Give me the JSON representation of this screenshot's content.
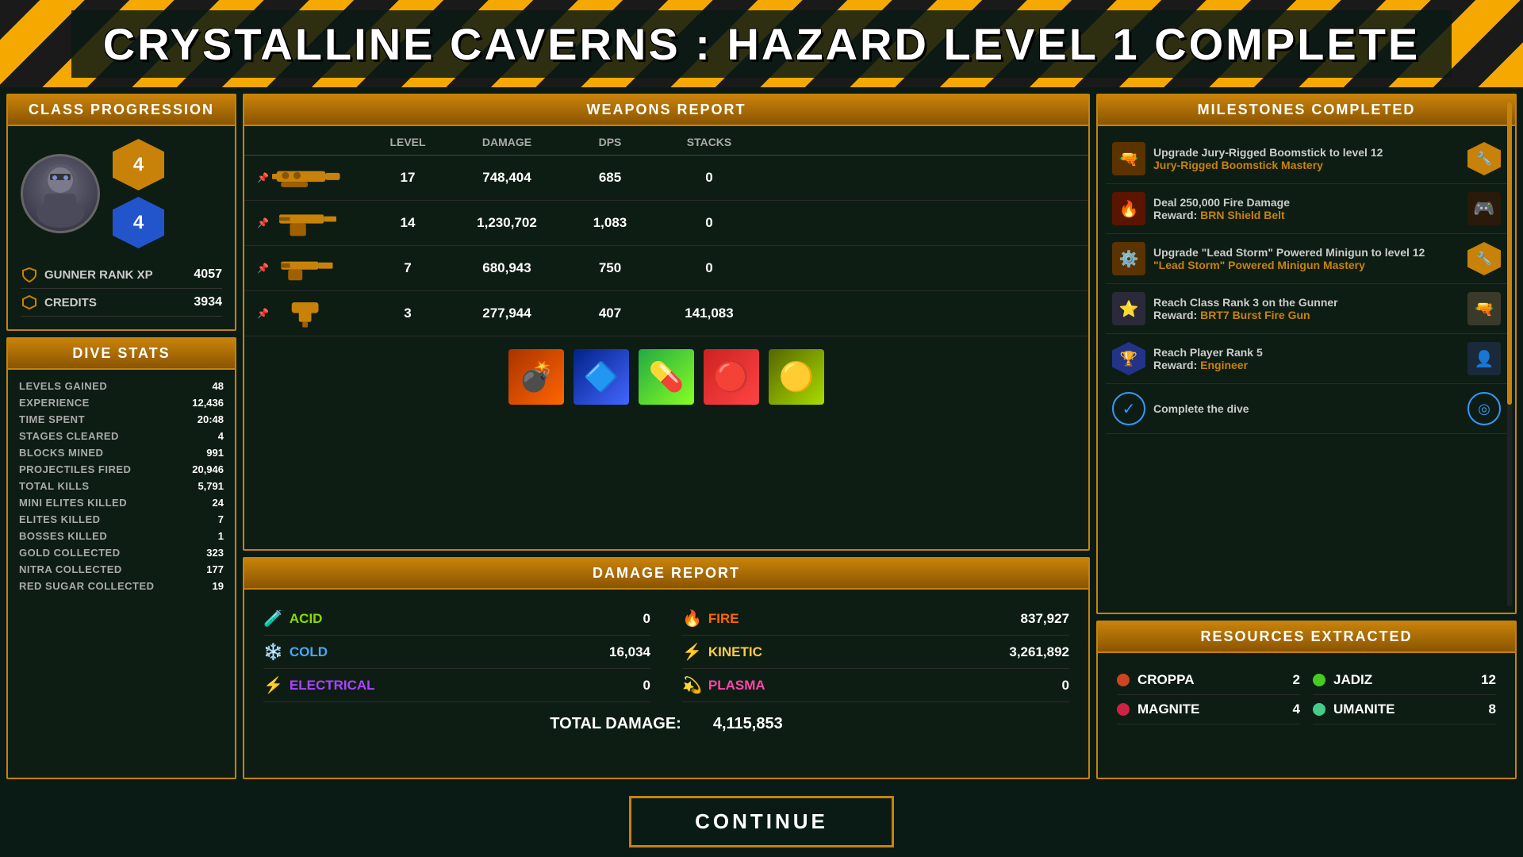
{
  "header": {
    "title": "CRYSTALLINE CAVERNS : HAZARD LEVEL 1 COMPLETE"
  },
  "class_progression": {
    "label": "CLASS PROGRESSION",
    "rank_badge_1": "4",
    "rank_badge_2": "4",
    "rank_xp_label": "GUNNER RANK XP",
    "rank_xp_value": "4057",
    "credits_label": "CREDITS",
    "credits_value": "3934"
  },
  "dive_stats": {
    "label": "DIVE STATS",
    "stats": [
      {
        "label": "LEVELS GAINED",
        "value": "48"
      },
      {
        "label": "EXPERIENCE",
        "value": "12,436"
      },
      {
        "label": "TIME SPENT",
        "value": "20:48"
      },
      {
        "label": "STAGES CLEARED",
        "value": "4"
      },
      {
        "label": "BLOCKS MINED",
        "value": "991"
      },
      {
        "label": "PROJECTILES FIRED",
        "value": "20,946"
      },
      {
        "label": "TOTAL KILLS",
        "value": "5,791"
      },
      {
        "label": "MINI ELITES KILLED",
        "value": "24"
      },
      {
        "label": "ELITES KILLED",
        "value": "7"
      },
      {
        "label": "BOSSES KILLED",
        "value": "1"
      },
      {
        "label": "GOLD COLLECTED",
        "value": "323"
      },
      {
        "label": "NITRA COLLECTED",
        "value": "177"
      },
      {
        "label": "RED SUGAR COLLECTED",
        "value": "19"
      }
    ]
  },
  "weapons_report": {
    "label": "WEAPONS REPORT",
    "columns": [
      "",
      "LEVEL",
      "DAMAGE",
      "DPS",
      "STACKS"
    ],
    "weapons": [
      {
        "icon": "minigun",
        "level": "17",
        "damage": "748,404",
        "dps": "685",
        "stacks": "0"
      },
      {
        "icon": "pistol",
        "level": "14",
        "damage": "1,230,702",
        "dps": "1,083",
        "stacks": "0"
      },
      {
        "icon": "handgun",
        "level": "7",
        "damage": "680,943",
        "dps": "750",
        "stacks": "0"
      },
      {
        "icon": "hammer",
        "level": "3",
        "damage": "277,944",
        "dps": "407",
        "stacks": "141,083"
      }
    ]
  },
  "damage_report": {
    "label": "DAMAGE REPORT",
    "types": [
      {
        "type": "ACID",
        "value": "0",
        "color": "acid"
      },
      {
        "type": "FIRE",
        "value": "837,927",
        "color": "fire"
      },
      {
        "type": "COLD",
        "value": "16,034",
        "color": "cold"
      },
      {
        "type": "KINETIC",
        "value": "3,261,892",
        "color": "kinetic"
      },
      {
        "type": "ELECTRICAL",
        "value": "0",
        "color": "electrical"
      },
      {
        "type": "PLASMA",
        "value": "0",
        "color": "plasma"
      }
    ],
    "total_label": "TOTAL DAMAGE:",
    "total_value": "4,115,853"
  },
  "milestones": {
    "label": "MILESTONES COMPLETED",
    "items": [
      {
        "title": "Upgrade Jury-Rigged Boomstick to level 12",
        "reward": "Jury-Rigged Boomstick Mastery",
        "icon_type": "gun",
        "badge_type": "hex"
      },
      {
        "title": "Deal 250,000 Fire Damage",
        "reward": "Reward: BRN Shield Belt",
        "reward_prefix": "Reward: ",
        "reward_name": "BRN Shield Belt",
        "icon_type": "fire",
        "badge_type": "image"
      },
      {
        "title": "Upgrade \"Lead Storm\" Powered Minigun to level 12",
        "reward": "\"Lead Storm\" Powered Minigun Mastery",
        "icon_type": "minigun",
        "badge_type": "hex"
      },
      {
        "title": "Reach Class Rank 3 on the Gunner",
        "reward": "Reward: BRT7 Burst Fire Gun",
        "reward_prefix": "Reward: ",
        "reward_name": "BRT7 Burst Fire Gun",
        "icon_type": "rank",
        "badge_type": "gun-icon"
      },
      {
        "title": "Reach Player Rank 5",
        "reward": "Reward: Engineer",
        "reward_prefix": "Reward: ",
        "reward_name": "Engineer",
        "icon_type": "hexagon",
        "badge_type": "character"
      },
      {
        "title": "Complete the dive",
        "reward": "",
        "icon_type": "check",
        "badge_type": "target"
      }
    ]
  },
  "resources": {
    "label": "RESOURCES EXTRACTED",
    "items": [
      {
        "name": "CROPPA",
        "value": "2",
        "color": "#cc4422"
      },
      {
        "name": "JADIZ",
        "value": "12",
        "color": "#44cc22"
      },
      {
        "name": "MAGNITE",
        "value": "4",
        "color": "#cc2244"
      },
      {
        "name": "UMANITE",
        "value": "8",
        "color": "#44cc88"
      }
    ]
  },
  "continue_button": {
    "label": "CONTINUE"
  }
}
